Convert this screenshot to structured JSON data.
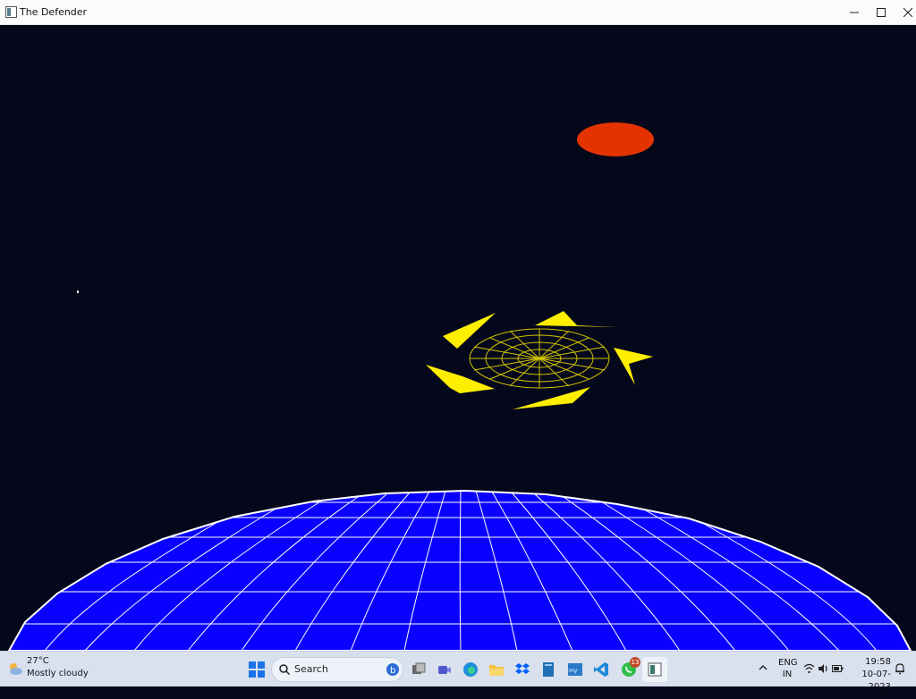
{
  "window": {
    "title": "The Defender"
  },
  "game": {
    "planet": {
      "name": "planet-globe",
      "fill": "#0a00ff",
      "grid": "#ffffff"
    },
    "sun": {
      "fill": "#e43300"
    },
    "enemy": {
      "hull": "#ffee00",
      "wireframe": "#d4c600"
    },
    "background": "#05071a"
  },
  "taskbar": {
    "weather": {
      "temperature": "27°C",
      "condition": "Mostly cloudy"
    },
    "search": {
      "placeholder": "Search"
    },
    "pinned_apps": [
      {
        "name": "start-icon"
      },
      {
        "name": "task-view-icon"
      },
      {
        "name": "meet-icon"
      },
      {
        "name": "edge-icon"
      },
      {
        "name": "file-explorer-icon"
      },
      {
        "name": "dropbox-icon"
      },
      {
        "name": "notes-icon"
      },
      {
        "name": "mysql-icon"
      },
      {
        "name": "vscode-icon"
      },
      {
        "name": "whatsapp-icon",
        "badge": "13"
      },
      {
        "name": "running-app-icon"
      }
    ],
    "tray": {
      "language_top": "ENG",
      "language_bottom": "IN",
      "time": "19:58",
      "date": "10-07-2023"
    }
  }
}
